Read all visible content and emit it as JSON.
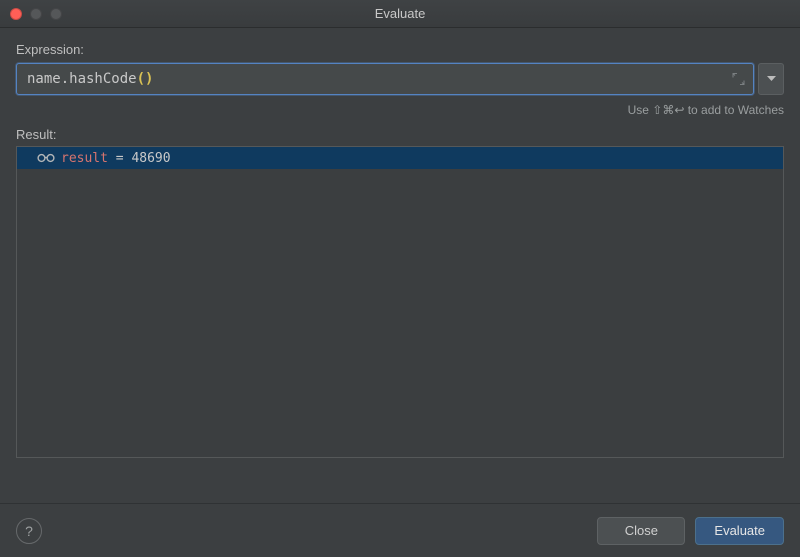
{
  "window": {
    "title": "Evaluate"
  },
  "labels": {
    "expression": "Expression:",
    "result": "Result:"
  },
  "expression": {
    "text_plain": "name.hashCode",
    "paren_open": "(",
    "paren_close": ")"
  },
  "hint": {
    "text": "Use ⇧⌘↩ to add to Watches"
  },
  "result": {
    "var_name": "result",
    "equals": " = ",
    "value": "48690"
  },
  "buttons": {
    "close": "Close",
    "evaluate": "Evaluate",
    "help": "?"
  }
}
